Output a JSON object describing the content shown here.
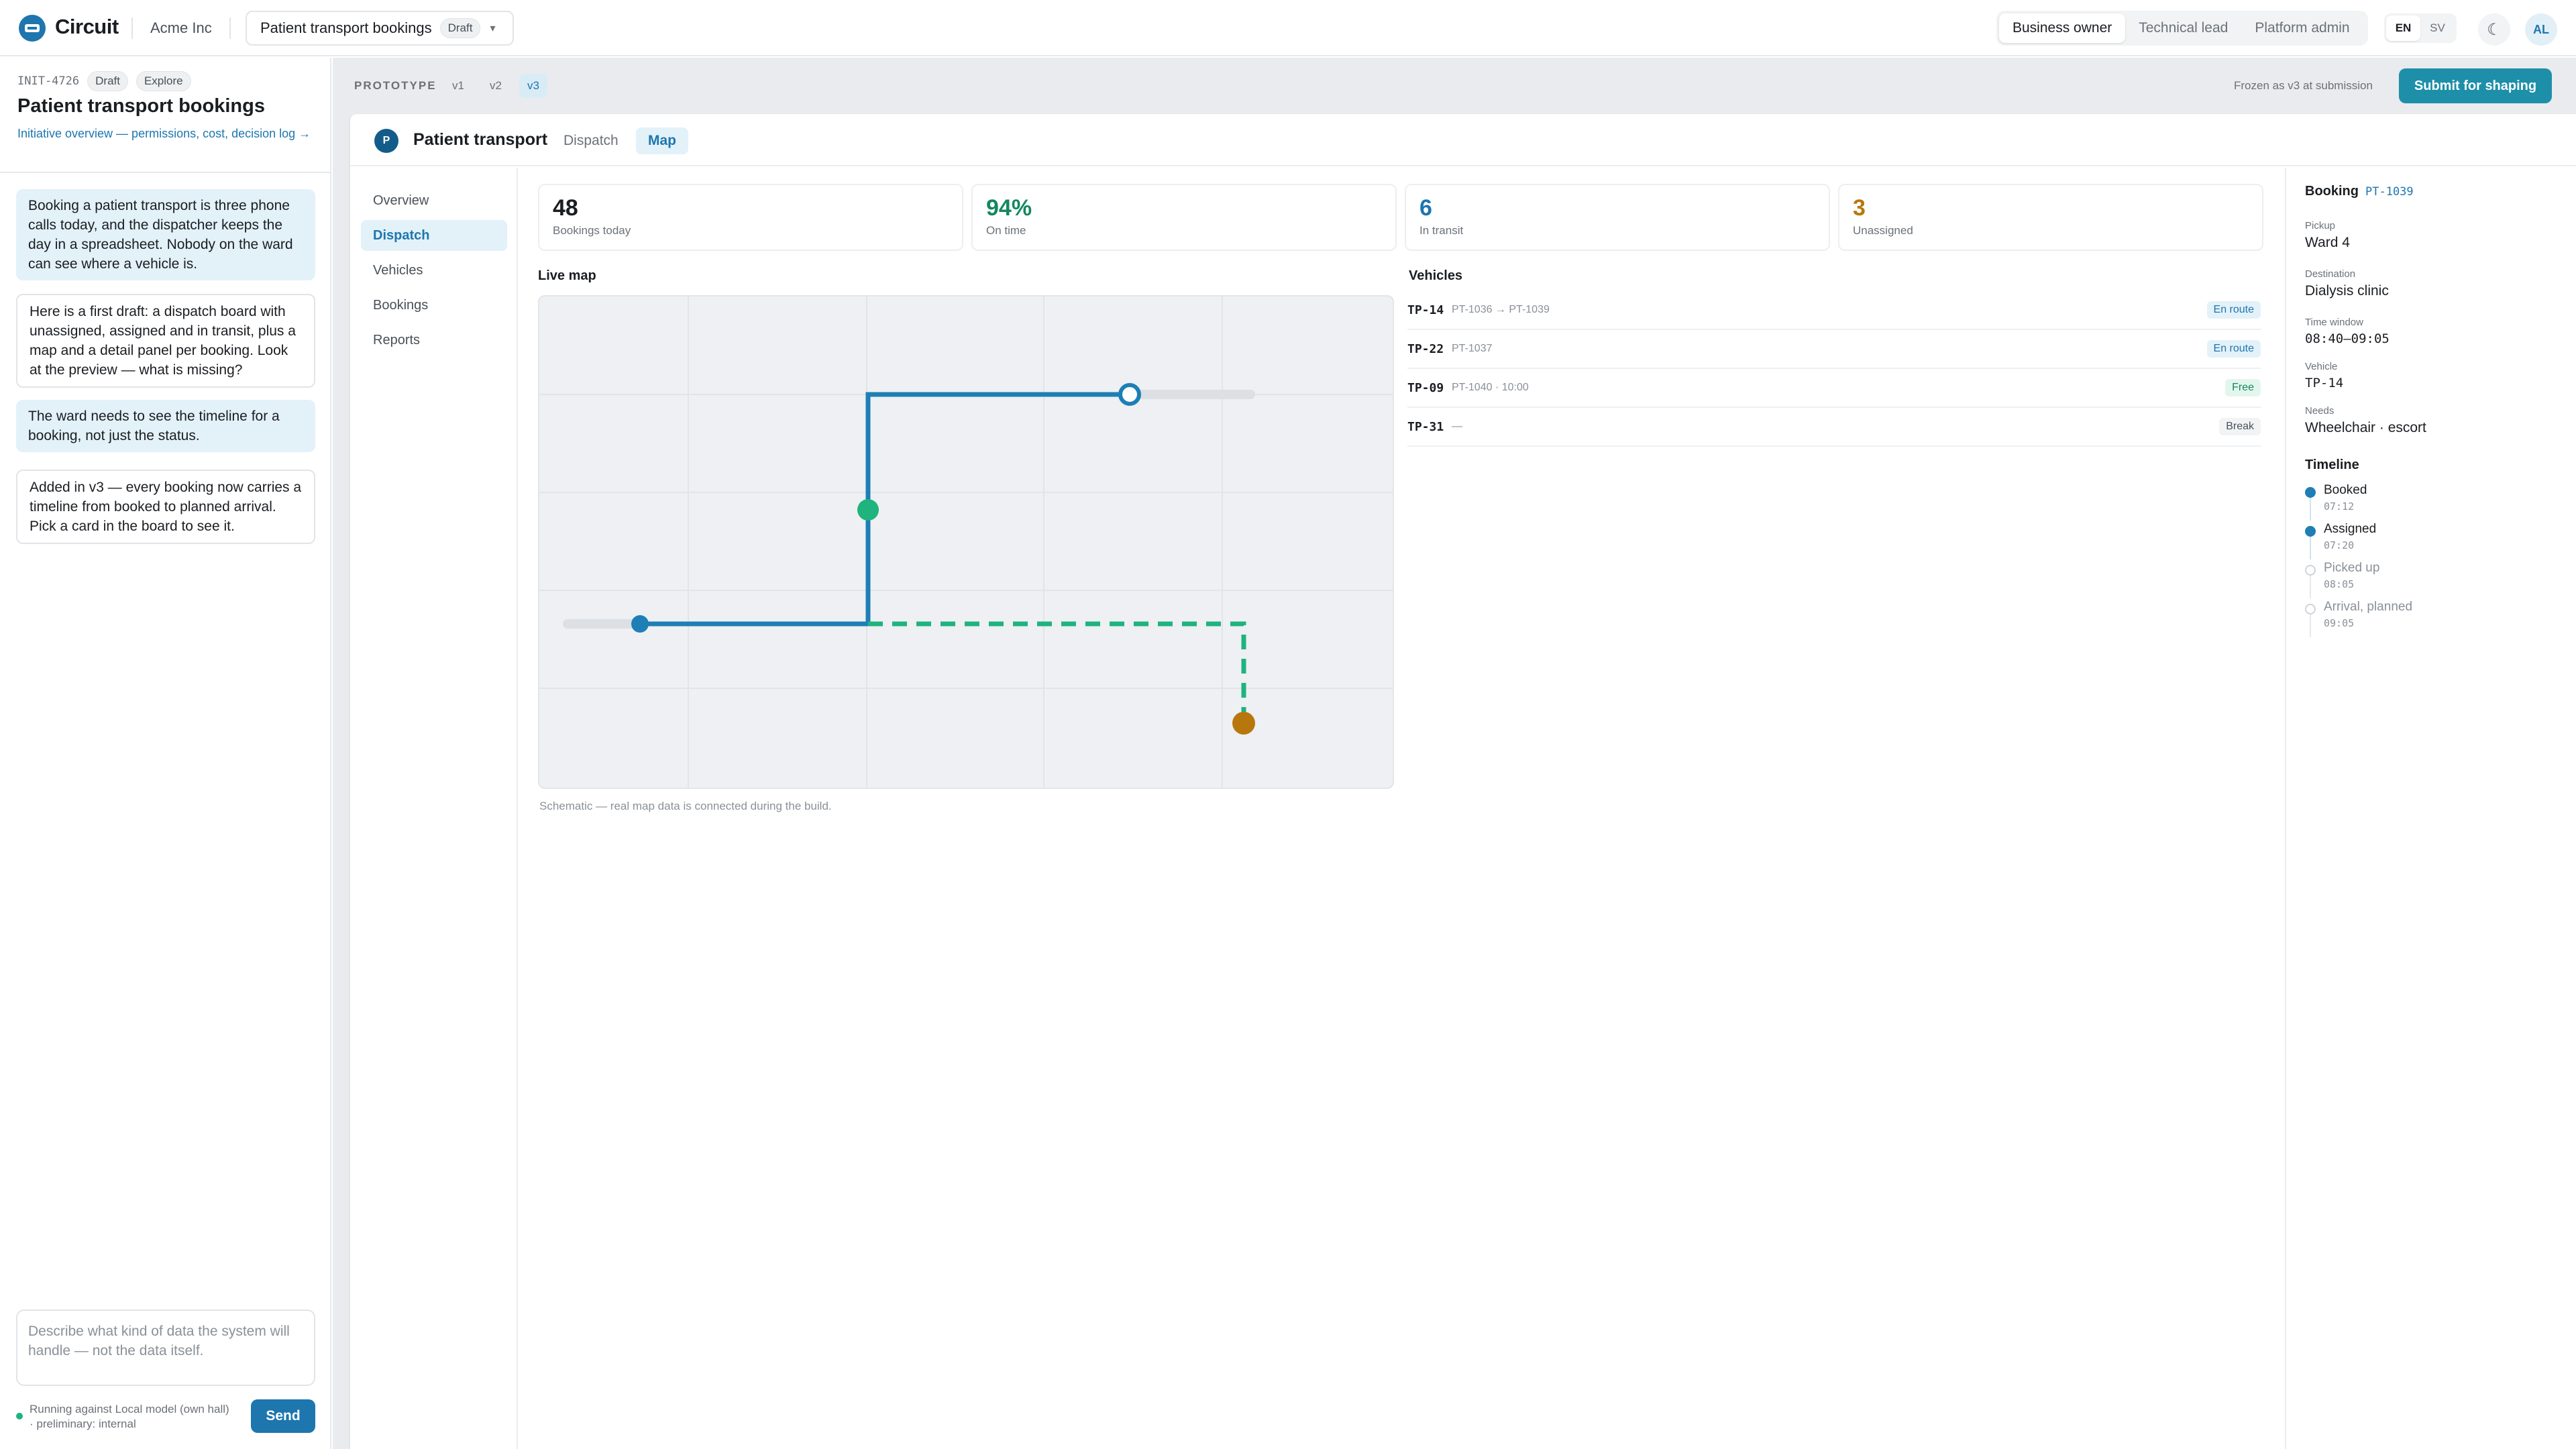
{
  "header": {
    "brand": "Circuit",
    "org": "Acme Inc",
    "project": "Patient transport bookings",
    "project_status": "Draft",
    "roles": [
      "Business owner",
      "Technical lead",
      "Platform admin"
    ],
    "active_role": "Business owner",
    "languages": [
      "EN",
      "SV"
    ],
    "active_language": "EN",
    "avatar_initials": "AL"
  },
  "initiative": {
    "id": "INIT-4726",
    "status": "Draft",
    "stage": "Explore",
    "title": "Patient transport bookings",
    "link": "Initiative overview — permissions, cost, decision log →"
  },
  "conversation": [
    {
      "role": "user",
      "text": "Booking a patient transport is three phone calls today, and the dispatcher keeps the day in a spreadsheet. Nobody on the ward can see where a vehicle is."
    },
    {
      "role": "assistant",
      "text": "Here is a first draft: a dispatch board with unassigned, assigned and in transit, plus a map and a detail panel per booking. Look at the preview — what is missing?"
    },
    {
      "role": "user",
      "text": "The ward needs to see the timeline for a booking, not just the status."
    },
    {
      "role": "assistant",
      "text": "Added in v3 — every booking now carries a timeline from booked to planned arrival. Pick a card in the board to see it."
    }
  ],
  "composer": {
    "placeholder": "Describe what kind of data the system will handle — not the data itself.",
    "status": "Running against Local model (own hall) · preliminary: internal",
    "send_label": "Send"
  },
  "prototype": {
    "label": "PROTOTYPE",
    "versions": [
      "v1",
      "v2",
      "v3"
    ],
    "active_version": "v3",
    "frozen_note": "Frozen as v3 at submission",
    "submit_label": "Submit for shaping"
  },
  "app": {
    "badge": "P",
    "title": "Patient transport",
    "tabs": [
      "Dispatch",
      "Map"
    ],
    "active_tab": "Map",
    "nav": [
      "Overview",
      "Dispatch",
      "Vehicles",
      "Bookings",
      "Reports"
    ],
    "active_nav": "Dispatch",
    "kpis": [
      {
        "value": "48",
        "label": "Bookings today",
        "color": "#1a1d21"
      },
      {
        "value": "94%",
        "label": "On time",
        "color": "#13875e"
      },
      {
        "value": "6",
        "label": "In transit",
        "color": "#1d76ae"
      },
      {
        "value": "3",
        "label": "Unassigned",
        "color": "#b8770d"
      }
    ],
    "map_title": "Live map",
    "map_note": "Schematic — real map data is connected during the build.",
    "vehicles_title": "Vehicles",
    "vehicles": [
      {
        "id": "TP-14",
        "detail": "PT-1036 → PT-1039",
        "status": "En route",
        "kind": "route"
      },
      {
        "id": "TP-22",
        "detail": "PT-1037",
        "status": "En route",
        "kind": "route"
      },
      {
        "id": "TP-09",
        "detail": "PT-1040 · 10:00",
        "status": "Free",
        "kind": "free"
      },
      {
        "id": "TP-31",
        "detail": "—",
        "status": "Break",
        "kind": "break"
      }
    ]
  },
  "booking": {
    "heading": "Booking",
    "id": "PT-1039",
    "fields": [
      {
        "label": "Pickup",
        "value": "Ward 4"
      },
      {
        "label": "Destination",
        "value": "Dialysis clinic"
      },
      {
        "label": "Time window",
        "value": "08:40–09:05"
      },
      {
        "label": "Vehicle",
        "value": "TP-14"
      },
      {
        "label": "Needs",
        "value": "Wheelchair · escort"
      }
    ],
    "timeline_title": "Timeline",
    "timeline": [
      {
        "label": "Booked",
        "time": "07:12",
        "done": true
      },
      {
        "label": "Assigned",
        "time": "07:20",
        "done": true
      },
      {
        "label": "Picked up",
        "time": "08:05",
        "done": false
      },
      {
        "label": "Arrival, planned",
        "time": "09:05",
        "done": false
      }
    ]
  },
  "colors": {
    "primary": "#1d76ae",
    "teal_button": "#1d8fa9",
    "green": "#1fb37e",
    "amber": "#b8770d"
  }
}
